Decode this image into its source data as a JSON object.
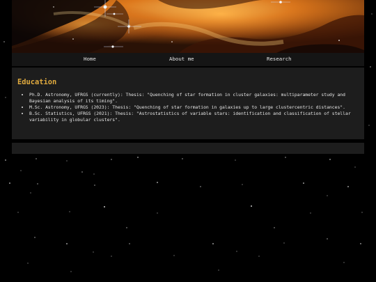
{
  "nav": {
    "items": [
      {
        "label": "Home"
      },
      {
        "label": "About me"
      },
      {
        "label": "Research"
      }
    ]
  },
  "education": {
    "title": "Education",
    "items": [
      "Ph.D. Astronomy, UFRGS (currently): Thesis: \"Quenching of star formation in cluster galaxies: multiparameter study and Bayesian analysis of its timing\".",
      "M.Sc. Astronomy, UFRGS (2023): Thesis: \"Quenching of star formation in galaxies up to large clustercentric distances\".",
      "B.Sc. Statistics, UFRGS (2021): Thesis: \"Astrostatistics of variable stars: identification and classification of stellar variability in globular clusters\"."
    ]
  },
  "colors": {
    "heading": "#e0aa3e",
    "panel": "#1d1d1d",
    "nav": "#151515",
    "background": "#000000"
  }
}
